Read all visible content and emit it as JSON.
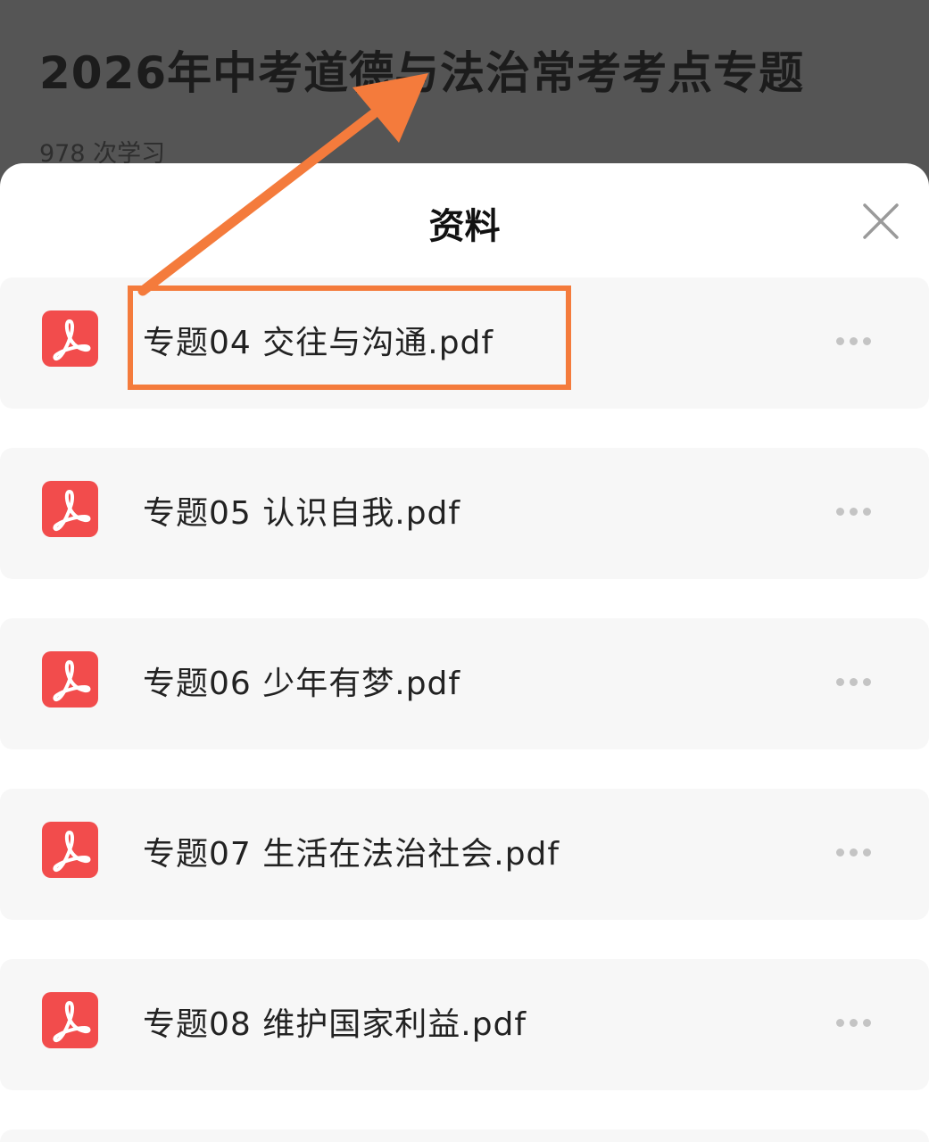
{
  "background_page": {
    "title": "2026年中考道德与法治常考考点专题",
    "study_count": "978 次学习"
  },
  "sheet": {
    "title": "资料",
    "close_icon": "close-icon"
  },
  "files": [
    {
      "name": "专题04 交往与沟通.pdf",
      "icon": "pdf-icon",
      "highlighted": true
    },
    {
      "name": "专题05 认识自我.pdf",
      "icon": "pdf-icon"
    },
    {
      "name": "专题06 少年有梦.pdf",
      "icon": "pdf-icon"
    },
    {
      "name": "专题07 生活在法治社会.pdf",
      "icon": "pdf-icon"
    },
    {
      "name": "专题08 维护国家利益.pdf",
      "icon": "pdf-icon"
    }
  ],
  "colors": {
    "pdf_icon": "#f24c4c",
    "annotation": "#f47b3c",
    "row_background": "#f7f7f7",
    "dim_overlay": "#555555"
  }
}
